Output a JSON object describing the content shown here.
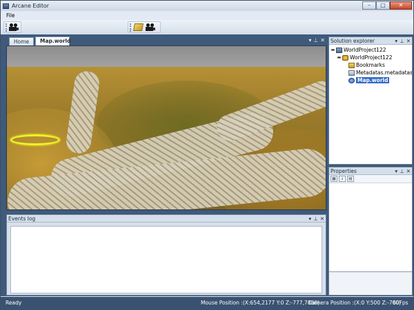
{
  "window": {
    "title": "Arcane Editor"
  },
  "menu": {
    "items": [
      "File"
    ]
  },
  "tabs": {
    "home": "Home",
    "active": "Map.world"
  },
  "solution_explorer": {
    "title": "Solution explorer",
    "items": [
      {
        "label": "WorldProject122",
        "icon": "project-icon"
      },
      {
        "label": "WorldProject122",
        "icon": "world-icon"
      },
      {
        "label": "Bookmarks",
        "icon": "bookmarks-icon"
      },
      {
        "label": "Metadatas.metadatas",
        "icon": "metadata-icon"
      },
      {
        "label": "Map.world",
        "icon": "map-icon",
        "selected": true
      }
    ]
  },
  "properties": {
    "title": "Properties"
  },
  "events_log": {
    "title": "Events log"
  },
  "status": {
    "state": "Ready",
    "mouse_position": "Mouse Position :(X:654,2177 Y:0 Z:-777,7866)",
    "camera_position": "Camera Position :(X:0 Y:500 Z:-700)",
    "fps": "60Fps"
  },
  "colors": {
    "selection": "#3169c6",
    "marker": "#ecf22a",
    "dock_background": "#3f5a7a"
  }
}
